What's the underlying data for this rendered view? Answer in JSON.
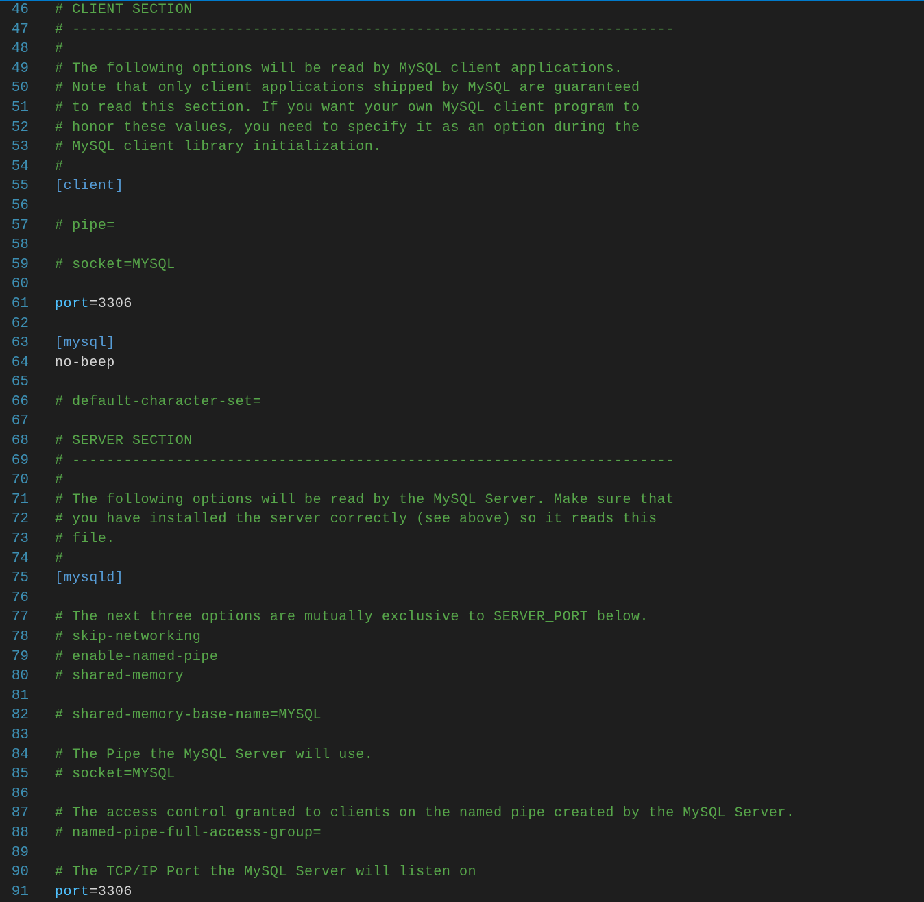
{
  "colors": {
    "background": "#1e1e1e",
    "line_number": "#3d8fb3",
    "comment": "#57a64a",
    "section": "#569cd6",
    "key": "#4fc1ff",
    "text": "#d4d4d4",
    "accent": "#007acc"
  },
  "lines": [
    {
      "n": "46",
      "type": "comment",
      "text": "# CLIENT SECTION"
    },
    {
      "n": "47",
      "type": "comment",
      "text": "# ----------------------------------------------------------------------"
    },
    {
      "n": "48",
      "type": "comment",
      "text": "#"
    },
    {
      "n": "49",
      "type": "comment",
      "text": "# The following options will be read by MySQL client applications."
    },
    {
      "n": "50",
      "type": "comment",
      "text": "# Note that only client applications shipped by MySQL are guaranteed"
    },
    {
      "n": "51",
      "type": "comment",
      "text": "# to read this section. If you want your own MySQL client program to"
    },
    {
      "n": "52",
      "type": "comment",
      "text": "# honor these values, you need to specify it as an option during the"
    },
    {
      "n": "53",
      "type": "comment",
      "text": "# MySQL client library initialization."
    },
    {
      "n": "54",
      "type": "comment",
      "text": "#"
    },
    {
      "n": "55",
      "type": "section",
      "text": "[client]"
    },
    {
      "n": "56",
      "type": "empty",
      "text": ""
    },
    {
      "n": "57",
      "type": "comment",
      "text": "# pipe="
    },
    {
      "n": "58",
      "type": "empty",
      "text": ""
    },
    {
      "n": "59",
      "type": "comment",
      "text": "# socket=MYSQL"
    },
    {
      "n": "60",
      "type": "empty",
      "text": ""
    },
    {
      "n": "61",
      "type": "kv",
      "key": "port",
      "value": "3306"
    },
    {
      "n": "62",
      "type": "empty",
      "text": ""
    },
    {
      "n": "63",
      "type": "section",
      "text": "[mysql]"
    },
    {
      "n": "64",
      "type": "plain",
      "text": "no-beep"
    },
    {
      "n": "65",
      "type": "empty",
      "text": ""
    },
    {
      "n": "66",
      "type": "comment",
      "text": "# default-character-set="
    },
    {
      "n": "67",
      "type": "empty",
      "text": ""
    },
    {
      "n": "68",
      "type": "comment",
      "text": "# SERVER SECTION"
    },
    {
      "n": "69",
      "type": "comment",
      "text": "# ----------------------------------------------------------------------"
    },
    {
      "n": "70",
      "type": "comment",
      "text": "#"
    },
    {
      "n": "71",
      "type": "comment",
      "text": "# The following options will be read by the MySQL Server. Make sure that"
    },
    {
      "n": "72",
      "type": "comment",
      "text": "# you have installed the server correctly (see above) so it reads this"
    },
    {
      "n": "73",
      "type": "comment",
      "text": "# file."
    },
    {
      "n": "74",
      "type": "comment",
      "text": "#"
    },
    {
      "n": "75",
      "type": "section",
      "text": "[mysqld]"
    },
    {
      "n": "76",
      "type": "empty",
      "text": ""
    },
    {
      "n": "77",
      "type": "comment",
      "text": "# The next three options are mutually exclusive to SERVER_PORT below."
    },
    {
      "n": "78",
      "type": "comment",
      "text": "# skip-networking"
    },
    {
      "n": "79",
      "type": "comment",
      "text": "# enable-named-pipe"
    },
    {
      "n": "80",
      "type": "comment",
      "text": "# shared-memory"
    },
    {
      "n": "81",
      "type": "empty",
      "text": ""
    },
    {
      "n": "82",
      "type": "comment",
      "text": "# shared-memory-base-name=MYSQL"
    },
    {
      "n": "83",
      "type": "empty",
      "text": ""
    },
    {
      "n": "84",
      "type": "comment",
      "text": "# The Pipe the MySQL Server will use."
    },
    {
      "n": "85",
      "type": "comment",
      "text": "# socket=MYSQL"
    },
    {
      "n": "86",
      "type": "empty",
      "text": ""
    },
    {
      "n": "87",
      "type": "comment",
      "text": "# The access control granted to clients on the named pipe created by the MySQL Server."
    },
    {
      "n": "88",
      "type": "comment",
      "text": "# named-pipe-full-access-group="
    },
    {
      "n": "89",
      "type": "empty",
      "text": ""
    },
    {
      "n": "90",
      "type": "comment",
      "text": "# The TCP/IP Port the MySQL Server will listen on"
    },
    {
      "n": "91",
      "type": "kv",
      "key": "port",
      "value": "3306"
    }
  ]
}
